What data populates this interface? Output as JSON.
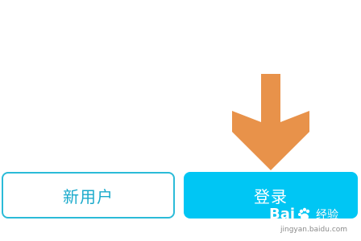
{
  "buttons": {
    "new_user_label": "新用户",
    "login_label": "登录"
  },
  "colors": {
    "login_bg": "#00c6f4",
    "new_user_border": "#2bbbd8",
    "arrow": "#e8924a"
  },
  "watermark": {
    "brand_left": "Bai",
    "brand_right": "经验",
    "url": "jingyan.baidu.com"
  },
  "icons": {
    "arrow": "down-arrow-icon",
    "paw": "baidu-paw-icon"
  }
}
